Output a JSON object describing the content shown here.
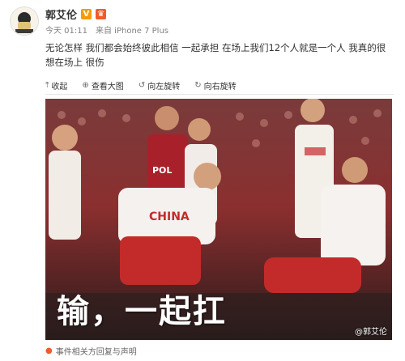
{
  "user": {
    "name": "郭艾伦",
    "badge_v": "V",
    "badge_vip": "♛"
  },
  "meta": {
    "time": "今天 01:11",
    "source": "来自 iPhone 7 Plus"
  },
  "post": {
    "text": "无论怎样 我们都会始终彼此相信 一起承担 在场上我们12个人就是一个人 我真的很想在场上 很伤"
  },
  "toolbar": {
    "collapse": "收起",
    "view_large": "查看大图",
    "rotate_left": "向左旋转",
    "rotate_right": "向右旋转"
  },
  "photo": {
    "caption": "输，一起扛",
    "watermark": "@郭艾伦",
    "jersey_china": "CHINA",
    "jersey_pol": "POL"
  },
  "footer": {
    "report": "事件相关方回复与声明"
  }
}
